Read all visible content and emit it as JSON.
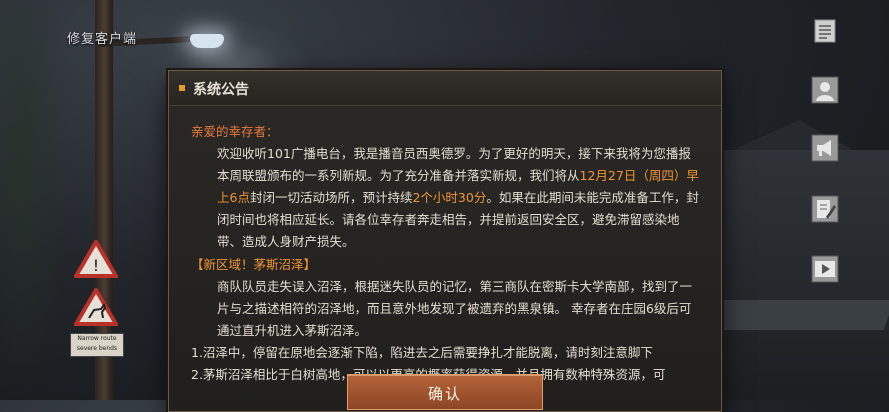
{
  "app": {
    "repair_client_label": "修复客户端"
  },
  "dialog": {
    "title": "系统公告",
    "watermark": "",
    "greeting": "亲爱的幸存者：",
    "paragraph1": [
      {
        "text": "欢迎收听101广播电台，我是播音员西奥德罗。为了更好的明天，接下来我将为您播报本周联盟颁布的一系列新规。为了充分准备并落实新规，我们将从",
        "hl": false
      },
      {
        "text": "12月27日（周四）早上6点",
        "hl": true
      },
      {
        "text": "封闭一切活动场所，预计持续",
        "hl": false
      },
      {
        "text": "2个小时30分",
        "hl": true
      },
      {
        "text": "。如果在此期间未能完成准备工作，封闭时间也将相应延长。请各位幸存者奔走相告，并提前返回安全区，避免滞留感染地带、造成人身财产损失。",
        "hl": false
      }
    ],
    "section_title": "【新区域！茅斯沼泽】",
    "paragraph2": "商队队员走失误入沼泽，根据迷失队员的记忆，第三商队在密斯卡大学南部，找到了一片与之描述相符的沼泽地，而且意外地发现了被遗弃的黑泉镇。 幸存者在庄园6级后可通过直升机进入茅斯沼泽。",
    "list": [
      "1.沼泽中，停留在原地会逐渐下陷，陷进去之后需要挣扎才能脱离，请时刻注意脚下",
      "2.茅斯沼泽相比于白树高地，可以以更高的概率获得资源。并且拥有数种特殊资源，可"
    ],
    "confirm_label": "确认"
  },
  "side_buttons": [
    {
      "icon": "notepad-icon"
    },
    {
      "icon": "profile-icon"
    },
    {
      "icon": "megaphone-icon"
    },
    {
      "icon": "edit-document-icon"
    },
    {
      "icon": "video-play-icon"
    }
  ],
  "background_signs": {
    "plate_text": [
      "Narrow route",
      "severe bends"
    ]
  },
  "colors": {
    "accent_orange": "#f2952f",
    "greeting_orange": "#e8793c",
    "dialog_bg": "#24221f",
    "button_bg": "#a25533"
  }
}
